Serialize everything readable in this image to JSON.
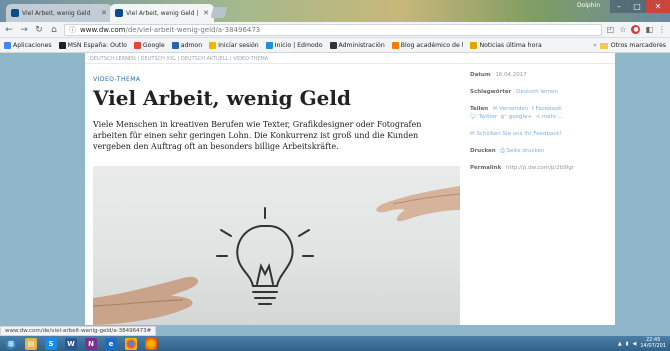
{
  "browser": {
    "tabs": [
      {
        "title": "Viel Arbeit, wenig Geld",
        "active": false
      },
      {
        "title": "Viel Arbeit, wenig Geld |",
        "active": true
      }
    ],
    "window_label": "Dolphin",
    "url_host": "www.dw.com",
    "url_path": "/de/viel-arbeit-wenig-geld/a-38496473",
    "bookmarks": [
      {
        "label": "Aplicaciones",
        "color": "#4285f4"
      },
      {
        "label": "MSN España: Outlo",
        "color": "#222222"
      },
      {
        "label": "Google",
        "color": "#ea4335"
      },
      {
        "label": "admon",
        "color": "#2a62b8"
      },
      {
        "label": "Iniciar sesión",
        "color": "#f4b400"
      },
      {
        "label": "Inicio | Edmodo",
        "color": "#1d8fe3"
      },
      {
        "label": "Administración",
        "color": "#333333"
      },
      {
        "label": "Blog académico de l",
        "color": "#f57c00"
      },
      {
        "label": "Noticias última hora",
        "color": "#e3a600"
      }
    ],
    "other_bookmarks": "Otros marcadores"
  },
  "article": {
    "breadcrumb": "DEUTSCH LERNEN | DEUTSCH XXL | DEUTSCH AKTUELL | VIDEO-THEMA",
    "kicker": "VIDEO-THEMA",
    "headline": "Viel Arbeit, wenig Geld",
    "teaser": "Viele Menschen in kreativen Berufen wie Texter, Grafikdesigner oder Fotografen arbeiten für einen sehr geringen Lohn. Die Konkurrenz ist groß und die Kunden vergeben den Auftrag oft an besonders billige Arbeitskräfte."
  },
  "sidebar": {
    "datum_label": "Datum",
    "datum_value": "16.04.2017",
    "schlag_label": "Schlagwörter",
    "schlag_value": "Deutsch lernen",
    "teilen_label": "Teilen",
    "share_items": [
      "Versenden",
      "Facebook",
      "Twitter",
      "google+",
      "mehr ..."
    ],
    "feedback": "Schicken Sie uns Ihr Feedback!",
    "drucken_label": "Drucken",
    "drucken_value": "Seite drucken",
    "permalink_label": "Permalink",
    "permalink_value": "http://p.dw.com/p/2b9lgr"
  },
  "status_url": "www.dw.com/de/viel-arbeit-wenig-geld/a-38496473#",
  "taskbar": {
    "time": "22:45",
    "date": "14/07/201"
  }
}
